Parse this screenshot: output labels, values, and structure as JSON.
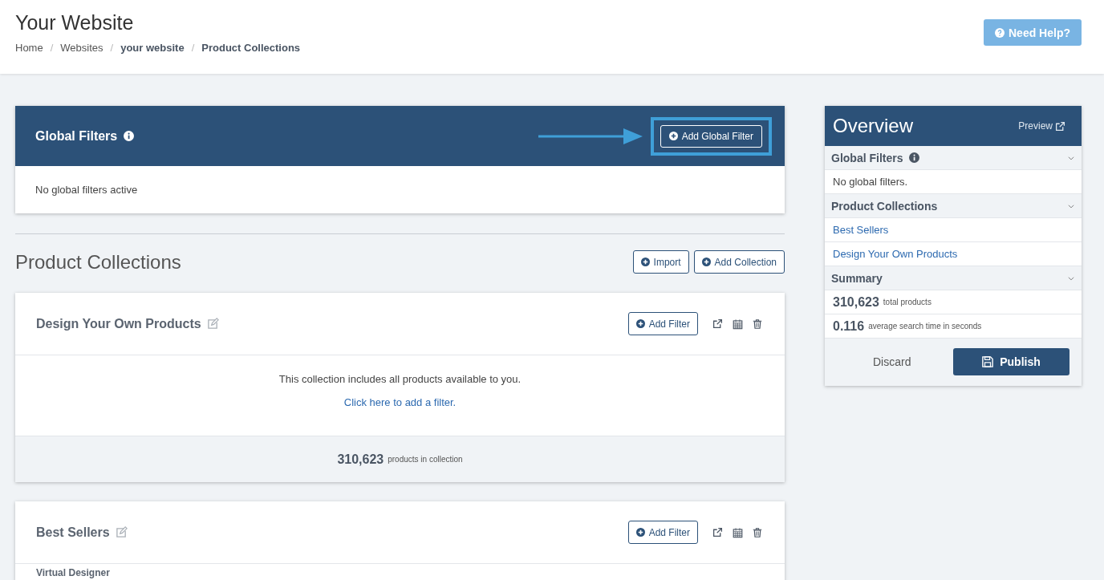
{
  "header": {
    "title": "Your Website",
    "breadcrumbs": [
      {
        "label": "Home",
        "current": false,
        "separator": "/"
      },
      {
        "label": "Websites",
        "current": false,
        "separator": "/"
      },
      {
        "label": "your website",
        "current": true,
        "separator": "/"
      },
      {
        "label": "Product Collections",
        "current": true
      }
    ],
    "help_button": "Need Help?"
  },
  "global_filters": {
    "title": "Global Filters",
    "add_button": "Add Global Filter",
    "highlighted": true,
    "empty_text": "No global filters active"
  },
  "collections_section": {
    "title": "Product Collections",
    "buttons": [
      "Import",
      "Add Collection"
    ]
  },
  "collections": [
    {
      "name": "Design Your Own Products",
      "add_filter": "Add Filter",
      "message": "This collection includes all products available to you.",
      "link": "Click here to add a filter.",
      "count": "310,623",
      "count_label": "products in collection"
    },
    {
      "name": "Best Sellers",
      "add_filter": "Add Filter",
      "rows": [
        {
          "label": "Virtual Designer"
        }
      ]
    }
  ],
  "overview": {
    "title": "Overview",
    "preview": "Preview",
    "sections": [
      {
        "kind": "text",
        "title": "Global Filters",
        "info": true,
        "items": [
          {
            "text": "No global filters."
          }
        ]
      },
      {
        "kind": "links",
        "title": "Product Collections",
        "info": false,
        "items": [
          {
            "text": "Best Sellers"
          },
          {
            "text": "Design Your Own Products"
          }
        ]
      },
      {
        "kind": "stats",
        "title": "Summary",
        "info": false,
        "items": [
          {
            "value": "310,623",
            "text": "total products"
          },
          {
            "value": "0.116",
            "text": "average search time in seconds"
          }
        ]
      }
    ],
    "discard": "Discard",
    "publish": "Publish"
  }
}
